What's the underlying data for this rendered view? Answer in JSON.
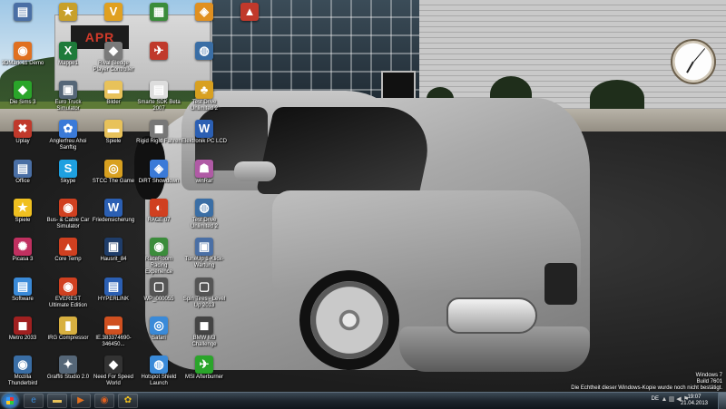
{
  "desktop": {
    "icons": [
      {
        "label": "",
        "glyph": "▤",
        "color": "#4a6fa5"
      },
      {
        "label": "",
        "glyph": "★",
        "color": "#c8a02a"
      },
      {
        "label": "",
        "glyph": "V",
        "color": "#e0a020"
      },
      {
        "label": "",
        "glyph": "▦",
        "color": "#3b8c3b"
      },
      {
        "label": "",
        "glyph": "◈",
        "color": "#e09020"
      },
      {
        "label": "",
        "glyph": "▲",
        "color": "#c0392b"
      },
      {
        "label": "3DMark 11 Demo",
        "glyph": "◉",
        "color": "#e07020"
      },
      {
        "label": "Mappe1",
        "glyph": "X",
        "color": "#1e7b3a"
      },
      {
        "label": "Rival Sledge Player Controller",
        "glyph": "◆",
        "color": "#7a7a7a"
      },
      {
        "label": "",
        "glyph": "✈",
        "color": "#c0392b"
      },
      {
        "label": "",
        "glyph": "◍",
        "color": "#3a6ea5"
      },
      {
        "label": "Die Sims 3",
        "glyph": "◆",
        "color": "#2aa52a"
      },
      {
        "label": "Euro Truck Simulator",
        "glyph": "▣",
        "color": "#556677"
      },
      {
        "label": "Bilder",
        "glyph": "▬",
        "color": "#e8c25a"
      },
      {
        "label": "Smarte SDK Beta 2007",
        "glyph": "▤",
        "color": "#dddddd"
      },
      {
        "label": "Test Drive Unlimited 2",
        "glyph": "♣",
        "color": "#d8a020"
      },
      {
        "label": "Uplay",
        "glyph": "✖",
        "color": "#c0392b"
      },
      {
        "label": "Anglerfreu Ahoi Sanftig",
        "glyph": "✿",
        "color": "#3a7ad8"
      },
      {
        "label": "Spiele",
        "glyph": "▬",
        "color": "#e8c25a"
      },
      {
        "label": "Rigid Rigid Fahren",
        "glyph": "◼",
        "color": "#777777"
      },
      {
        "label": "Elektronik PC LCD",
        "glyph": "W",
        "color": "#2b5fb3"
      },
      {
        "label": "Office",
        "glyph": "▤",
        "color": "#4a6fa5"
      },
      {
        "label": "Skype",
        "glyph": "S",
        "color": "#1ea0e0"
      },
      {
        "label": "STCC The Game",
        "glyph": "◎",
        "color": "#d8a020"
      },
      {
        "label": "DiRT Showdown",
        "glyph": "◈",
        "color": "#3a7ad8"
      },
      {
        "label": "winRar",
        "glyph": "☗",
        "color": "#b05aa5"
      },
      {
        "label": "Spiele",
        "glyph": "★",
        "color": "#f0c020"
      },
      {
        "label": "Bus- & Cable Car Simulator",
        "glyph": "◉",
        "color": "#d04020"
      },
      {
        "label": "Friedensicherung",
        "glyph": "W",
        "color": "#2b5fb3"
      },
      {
        "label": "RACE 07",
        "glyph": "◐",
        "color": "#d04020"
      },
      {
        "label": "Test Drive Unlimited 2",
        "glyph": "◍",
        "color": "#3a6ea5"
      },
      {
        "label": "Picasa 3",
        "glyph": "✺",
        "color": "#c03060"
      },
      {
        "label": "Core Temp",
        "glyph": "▲",
        "color": "#d04020"
      },
      {
        "label": "Hausrit_84",
        "glyph": "▣",
        "color": "#1f3d6a"
      },
      {
        "label": "RaceRoom Racing Experience",
        "glyph": "◉",
        "color": "#3b8c3b"
      },
      {
        "label": "TuneUp 1-Klick-Wartung",
        "glyph": "▣",
        "color": "#4a6fa5"
      },
      {
        "label": "Software",
        "glyph": "▤",
        "color": "#3a8ad8"
      },
      {
        "label": "EVEREST Ultimate Edition",
        "glyph": "◉",
        "color": "#d04020"
      },
      {
        "label": "HYPERLINK",
        "glyph": "▤",
        "color": "#2b5fb3"
      },
      {
        "label": "WP_000055",
        "glyph": "▢",
        "color": "#555555"
      },
      {
        "label": "Spin Tires - Level Up 2013",
        "glyph": "▢",
        "color": "#555555"
      },
      {
        "label": "Metro 2033",
        "glyph": "◼",
        "color": "#a02020"
      },
      {
        "label": "IRG Compressor",
        "glyph": "▮",
        "color": "#d8b040"
      },
      {
        "label": "IE.383374690-346450...",
        "glyph": "▬",
        "color": "#d05020"
      },
      {
        "label": "Safari",
        "glyph": "◎",
        "color": "#3a8ad8"
      },
      {
        "label": "BMW M3 Challenge",
        "glyph": "◼",
        "color": "#444444"
      },
      {
        "label": "Mozilla Thunderbird",
        "glyph": "◉",
        "color": "#3a6ea5"
      },
      {
        "label": "Graffiti Studio 2.0",
        "glyph": "✦",
        "color": "#556677"
      },
      {
        "label": "Need For Speed World",
        "glyph": "◆",
        "color": "#333333"
      },
      {
        "label": "Hotspot Shield Launch",
        "glyph": "◍",
        "color": "#3a8ad8"
      },
      {
        "label": "MSI Afterburner",
        "glyph": "✈",
        "color": "#2aa52a"
      }
    ]
  },
  "watermark": {
    "line1": "Windows 7",
    "line2": "Build 7601",
    "line3": "Die Echtheit dieser Windows-Kopie wurde noch nicht bestätigt."
  },
  "taskbar": {
    "pinned": [
      {
        "name": "internet-explorer",
        "glyph": "e",
        "color": "#3a8ad8"
      },
      {
        "name": "windows-explorer",
        "glyph": "▬",
        "color": "#e8c25a"
      },
      {
        "name": "media-player",
        "glyph": "▶",
        "color": "#e07020"
      },
      {
        "name": "firefox",
        "glyph": "◉",
        "color": "#e06020"
      },
      {
        "name": "app",
        "glyph": "✿",
        "color": "#f0c020"
      }
    ],
    "language": "DE",
    "time": "19:07",
    "date": "21.04.2013"
  }
}
